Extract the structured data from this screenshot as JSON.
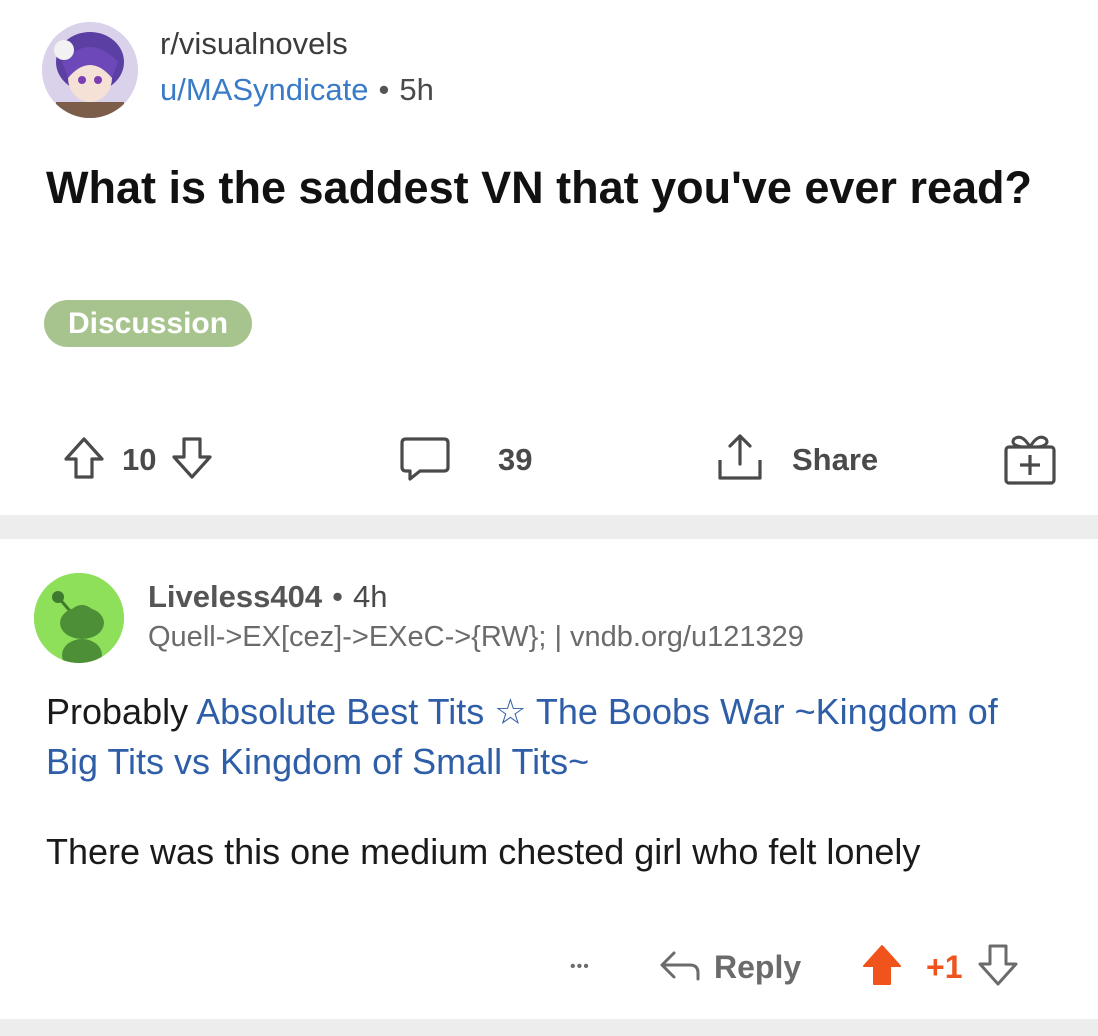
{
  "post": {
    "subreddit": "r/visualnovels",
    "author": "u/MASyndicate",
    "separator": "•",
    "age": "5h",
    "title": "What is the saddest VN that you've ever read?",
    "flair": "Discussion",
    "actions": {
      "upvotes": "10",
      "comments": "39",
      "share_label": "Share"
    }
  },
  "comment": {
    "author": "Liveless404",
    "separator": "•",
    "age": "4h",
    "user_flair": "Quell->EX[cez]->EXeC->{RW}; | vndb.org/u121329",
    "body_prefix": "Probably ",
    "body_link": "Absolute Best Tits ☆ The Boobs War ~Kingdom of Big Tits vs Kingdom of Small Tits~",
    "body_second": "There was this one medium chested girl who felt lonely",
    "actions": {
      "more": "•••",
      "reply_label": "Reply",
      "score": "+1"
    }
  },
  "colors": {
    "link": "#3a7bc8",
    "flair_bg": "#a8c48e",
    "upvote_active": "#f0531c",
    "divider": "#ededed"
  },
  "icons": [
    "upvote-icon",
    "downvote-icon",
    "comment-icon",
    "share-icon",
    "award-icon",
    "reply-icon",
    "more-icon"
  ]
}
